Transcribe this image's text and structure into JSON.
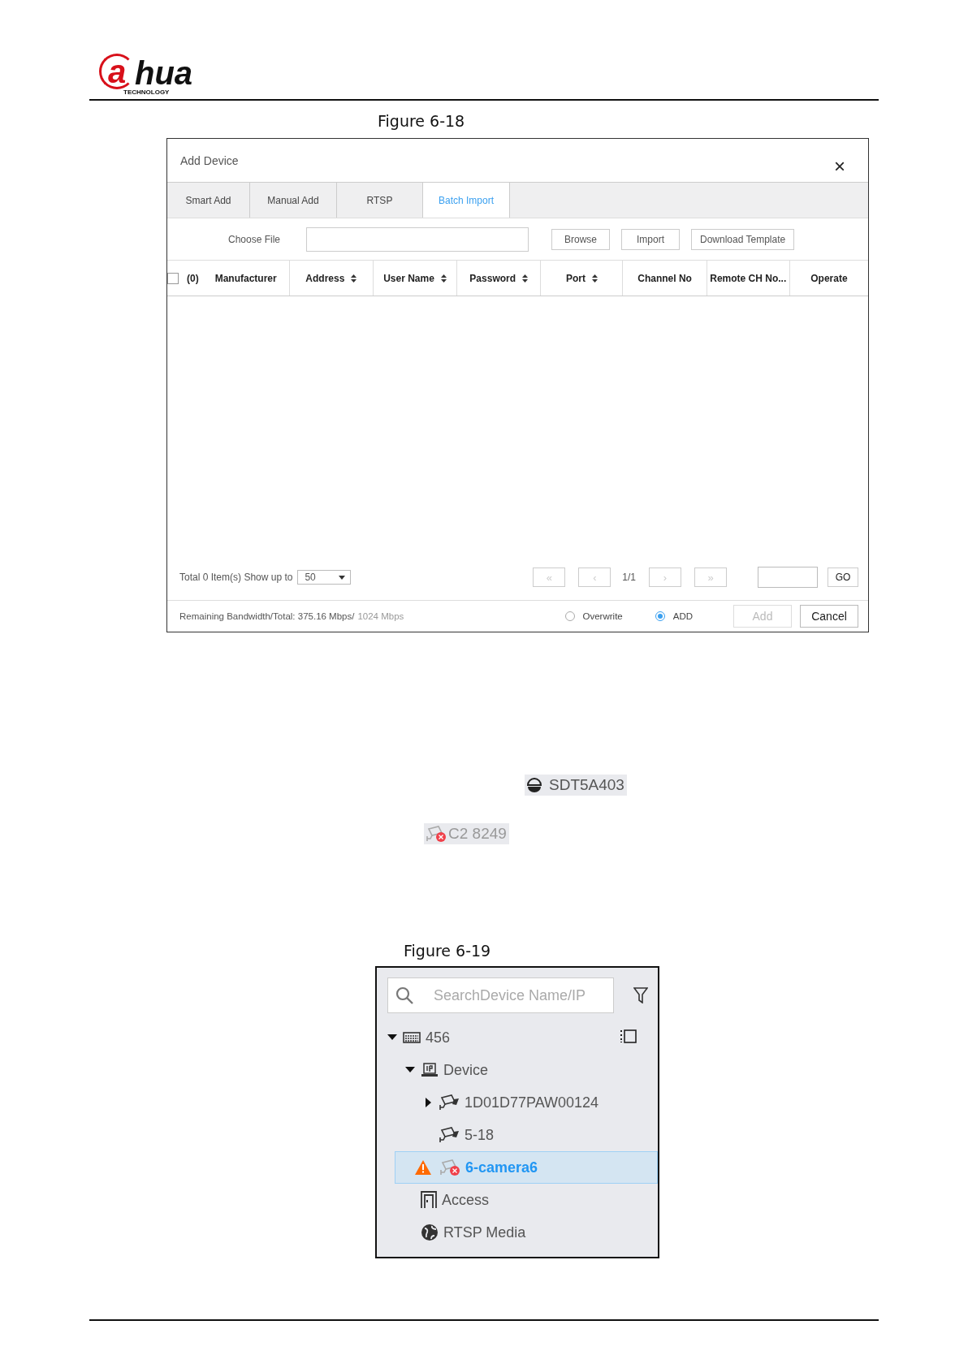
{
  "header": {
    "logo": {
      "mark": "a",
      "name": "hua",
      "tagline": "TECHNOLOGY"
    }
  },
  "figure_1": {
    "caption": "Figure 6-18",
    "dialog": {
      "title": "Add Device",
      "close": "×",
      "tabs": [
        {
          "label": "Smart Add",
          "selected": false
        },
        {
          "label": "Manual Add",
          "selected": false
        },
        {
          "label": "RTSP",
          "selected": false
        },
        {
          "label": "Batch Import",
          "selected": true
        }
      ],
      "choose_file": {
        "label": "Choose File"
      },
      "buttons": [
        "Browse",
        "Import",
        "Download Template"
      ],
      "table": {
        "select_all": {
          "checked": false
        },
        "count": "(0)",
        "columns": [
          {
            "label": "Manufacturer",
            "sortable": false
          },
          {
            "label": "Address",
            "sortable": true
          },
          {
            "label": "User Name",
            "sortable": true
          },
          {
            "label": "Password",
            "sortable": true
          },
          {
            "label": "Port",
            "sortable": true
          },
          {
            "label": "Channel No",
            "sortable": false
          },
          {
            "label": "Remote CH No...",
            "sortable": false
          },
          {
            "label": "Operate",
            "sortable": false
          }
        ]
      },
      "footer": {
        "total": "Total 0 Item(s)",
        "show_up_to": "Show up to",
        "page_size": "50",
        "pager": [
          {
            "label": "«",
            "disabled": true
          },
          {
            "label": "‹",
            "disabled": true
          }
        ],
        "page": "1/1",
        "pager_next": [
          {
            "label": "›",
            "disabled": true
          },
          {
            "label": "»",
            "disabled": true
          }
        ],
        "go": "GO"
      },
      "bottom": {
        "bandwidth": "Remaining Bandwidth/Total: 375.16 Mbps/",
        "total": "1024 Mbps",
        "modes": [
          {
            "label": "Overwrite",
            "selected": false
          },
          {
            "label": "ADD",
            "selected": true
          }
        ],
        "actions": [
          {
            "label": "Add",
            "disabled": true
          },
          {
            "label": "Cancel",
            "disabled": false
          }
        ]
      }
    }
  },
  "status_icons": [
    {
      "kind": "dome",
      "label": "SDT5A403"
    },
    {
      "kind": "camera_offline",
      "label": "C2 8249"
    }
  ],
  "figure_2": {
    "caption": "Figure 6-19",
    "tree": {
      "search": {
        "placeholder": "SearchDevice Name/IP"
      },
      "items": [
        {
          "label": "456",
          "kind": "server",
          "expanded": true,
          "selected": false,
          "warning": false,
          "children": [
            {
              "label": "Device",
              "kind": "ip",
              "expanded": true,
              "selected": false,
              "warning": false,
              "children": [
                {
                  "label": "1D01D77PAW00124",
                  "kind": "camera",
                  "expanded": false,
                  "selected": false,
                  "warning": false
                },
                {
                  "label": "5-18",
                  "kind": "camera",
                  "selected": false,
                  "warning": false
                },
                {
                  "label": "6-camera6",
                  "kind": "camera_offline",
                  "selected": true,
                  "warning": true
                }
              ]
            },
            {
              "label": "Access",
              "kind": "door",
              "selected": false,
              "warning": false
            },
            {
              "label": "RTSP Media",
              "kind": "globe",
              "selected": false,
              "warning": false
            }
          ]
        }
      ]
    }
  }
}
